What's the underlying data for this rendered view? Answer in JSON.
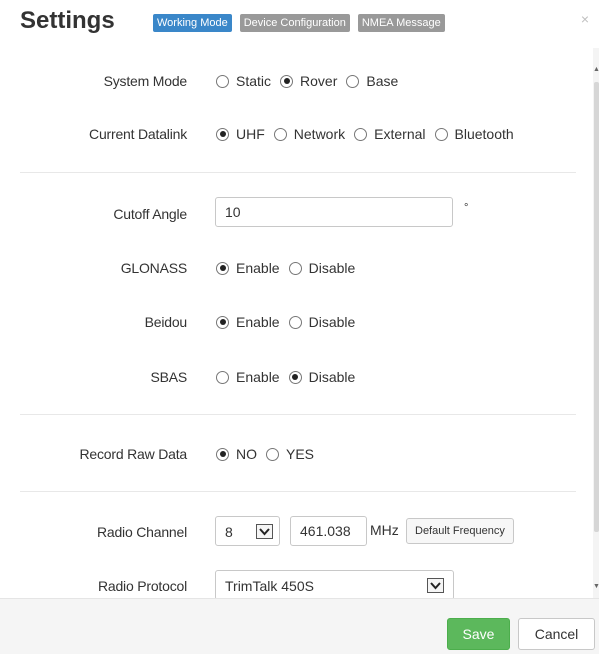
{
  "header": {
    "title": "Settings",
    "tabs": [
      {
        "label": "Working Mode",
        "active": true
      },
      {
        "label": "Device Configuration",
        "active": false
      },
      {
        "label": "NMEA Message",
        "active": false
      }
    ],
    "close_glyph": "×"
  },
  "form": {
    "system_mode": {
      "label": "System Mode",
      "options": [
        "Static",
        "Rover",
        "Base"
      ],
      "selected": "Rover"
    },
    "datalink": {
      "label": "Current Datalink",
      "options": [
        "UHF",
        "Network",
        "External",
        "Bluetooth"
      ],
      "selected": "UHF"
    },
    "cutoff_angle": {
      "label": "Cutoff Angle",
      "value": "10",
      "unit": "°"
    },
    "glonass": {
      "label": "GLONASS",
      "options": [
        "Enable",
        "Disable"
      ],
      "selected": "Enable"
    },
    "beidou": {
      "label": "Beidou",
      "options": [
        "Enable",
        "Disable"
      ],
      "selected": "Enable"
    },
    "sbas": {
      "label": "SBAS",
      "options": [
        "Enable",
        "Disable"
      ],
      "selected": "Disable"
    },
    "raw_data": {
      "label": "Record Raw Data",
      "options": [
        "NO",
        "YES"
      ],
      "selected": "NO"
    },
    "radio_channel": {
      "label": "Radio Channel",
      "channel": "8",
      "frequency": "461.038",
      "unit": "MHz",
      "default_button": "Default Frequency"
    },
    "radio_protocol": {
      "label": "Radio Protocol",
      "value": "TrimTalk 450S"
    }
  },
  "footer": {
    "save_label": "Save",
    "cancel_label": "Cancel"
  },
  "colors": {
    "tab_active": "#3a87c9",
    "tab_inactive": "#999999",
    "save": "#5cb85c"
  }
}
